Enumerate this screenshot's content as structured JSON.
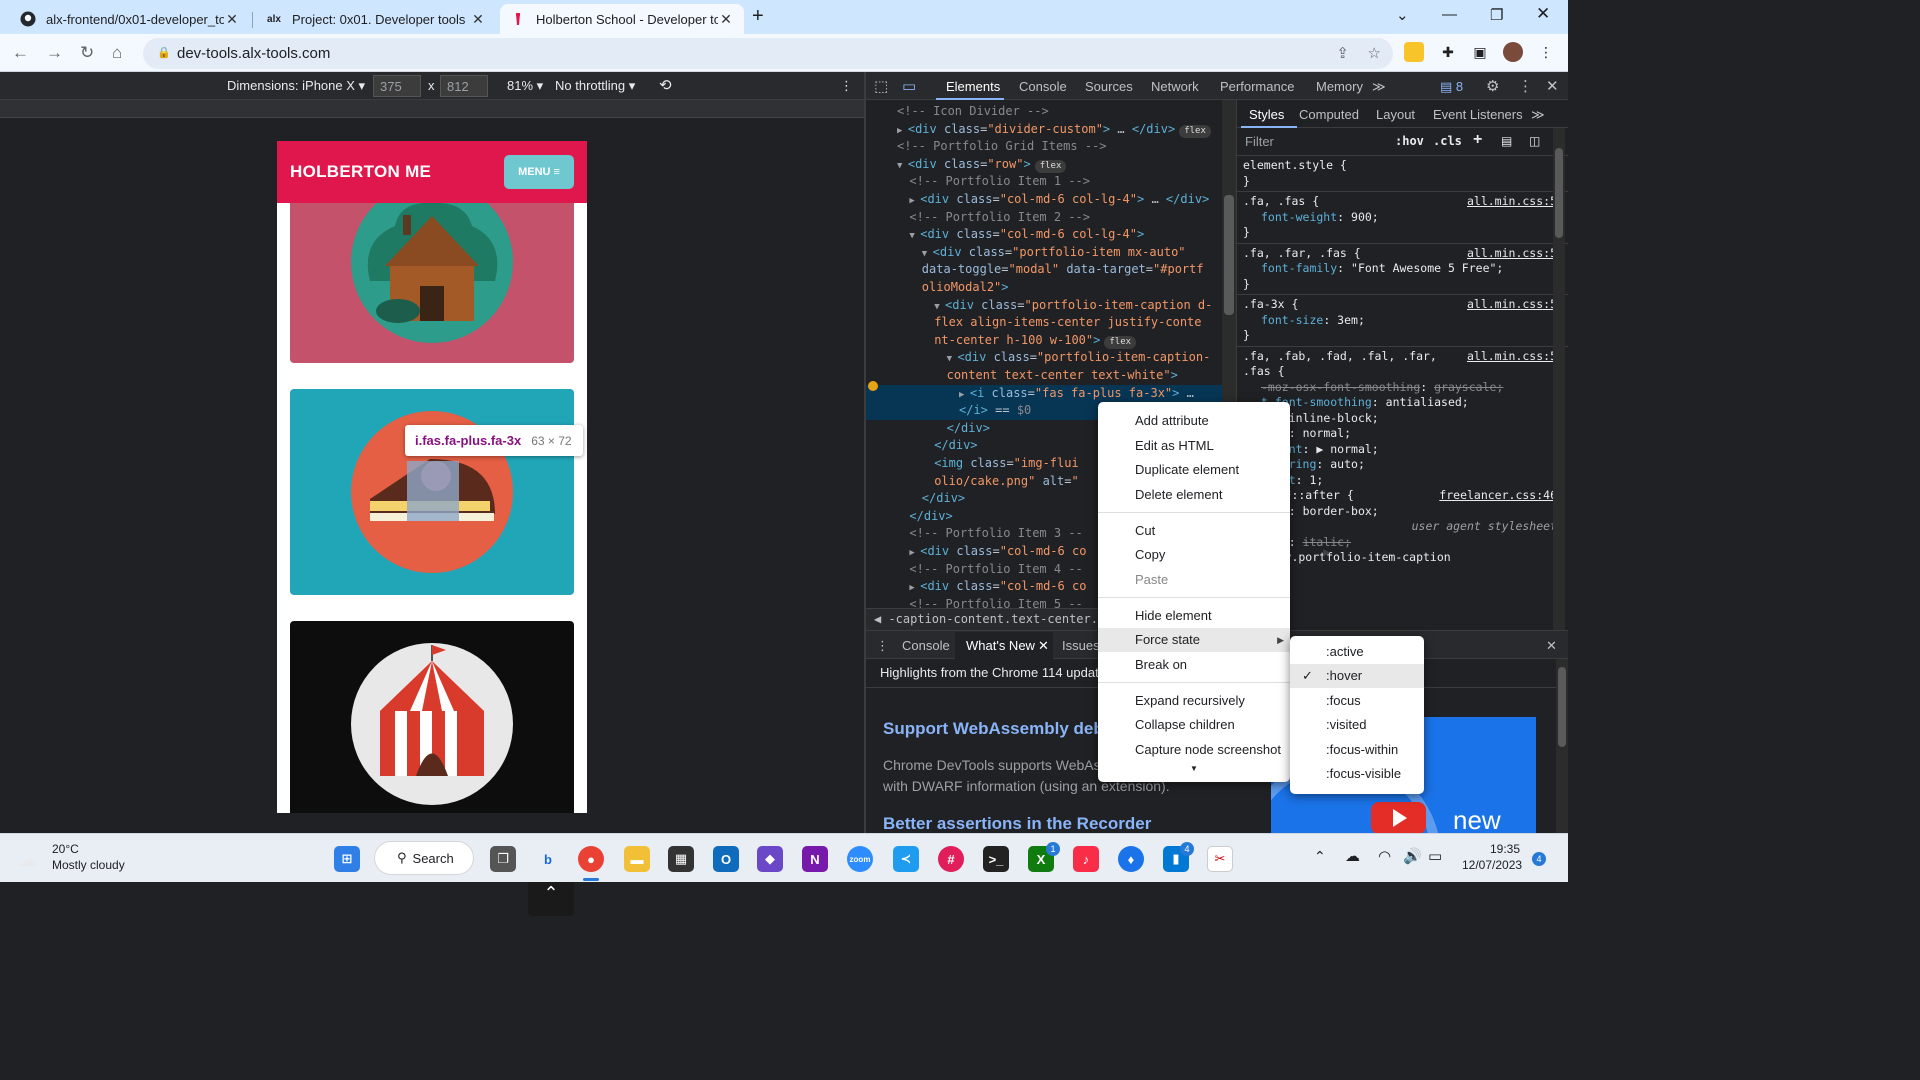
{
  "browser": {
    "tabs": [
      {
        "title": "alx-frontend/0x01-developer_too",
        "favicon": "github-icon"
      },
      {
        "title": "Project: 0x01. Developer tools | N",
        "favicon": "alx-icon"
      },
      {
        "title": "Holberton School - Developer to",
        "favicon": "holberton-icon"
      }
    ],
    "url": "dev-tools.alx-tools.com"
  },
  "device_toolbar": {
    "dimensions_label": "Dimensions: iPhone X",
    "width": "375",
    "times": "x",
    "height": "812",
    "zoom": "81%",
    "throttling": "No throttling"
  },
  "page": {
    "brand": "HOLBERTON ME",
    "menu_label": "MENU",
    "tooltip_selector": "i.fas.fa-plus.fa-3x",
    "tooltip_size": "63 × 72",
    "item_colors": [
      "#c4526a",
      "#21a6b8",
      "#0e0d0d"
    ]
  },
  "devtools": {
    "tabs": [
      "Elements",
      "Console",
      "Sources",
      "Network",
      "Performance",
      "Memory"
    ],
    "issues_count": "8",
    "elements_lines": [
      {
        "indent": 5,
        "arrow": "",
        "parts": [
          [
            "cm",
            "<!-- Icon Divider -->"
          ]
        ]
      },
      {
        "indent": 5,
        "arrow": "▶",
        "parts": [
          [
            "tag",
            "<div "
          ],
          [
            "an",
            "class"
          ],
          [
            "pl",
            "="
          ],
          [
            "av",
            "\"divider-custom\""
          ],
          [
            "tag",
            ">"
          ],
          [
            "pl",
            " … "
          ],
          [
            "tag",
            "</div>"
          ]
        ],
        "badge": "flex"
      },
      {
        "indent": 5,
        "arrow": "",
        "parts": [
          [
            "cm",
            "<!-- Portfolio Grid Items -->"
          ]
        ]
      },
      {
        "indent": 5,
        "arrow": "▼",
        "parts": [
          [
            "tag",
            "<div "
          ],
          [
            "an",
            "class"
          ],
          [
            "pl",
            "="
          ],
          [
            "av",
            "\"row\""
          ],
          [
            "tag",
            ">"
          ]
        ],
        "badge": "flex"
      },
      {
        "indent": 7,
        "arrow": "",
        "parts": [
          [
            "cm",
            "<!-- Portfolio Item 1 -->"
          ]
        ]
      },
      {
        "indent": 7,
        "arrow": "▶",
        "parts": [
          [
            "tag",
            "<div "
          ],
          [
            "an",
            "class"
          ],
          [
            "pl",
            "="
          ],
          [
            "av",
            "\"col-md-6 col-lg-4\""
          ],
          [
            "tag",
            ">"
          ],
          [
            "pl",
            " … "
          ],
          [
            "tag",
            "</div>"
          ]
        ]
      },
      {
        "indent": 7,
        "arrow": "",
        "parts": [
          [
            "cm",
            "<!-- Portfolio Item 2 -->"
          ]
        ]
      },
      {
        "indent": 7,
        "arrow": "▼",
        "parts": [
          [
            "tag",
            "<div "
          ],
          [
            "an",
            "class"
          ],
          [
            "pl",
            "="
          ],
          [
            "av",
            "\"col-md-6 col-lg-4\""
          ],
          [
            "tag",
            ">"
          ]
        ]
      },
      {
        "indent": 9,
        "arrow": "▼",
        "parts": [
          [
            "tag",
            "<div "
          ],
          [
            "an",
            "class"
          ],
          [
            "pl",
            "="
          ],
          [
            "av",
            "\"portfolio-item mx-auto\""
          ]
        ]
      },
      {
        "indent": 9,
        "arrow": "",
        "parts": [
          [
            "an",
            "data-toggle"
          ],
          [
            "pl",
            "="
          ],
          [
            "av",
            "\"modal\" "
          ],
          [
            "an",
            "data-target"
          ],
          [
            "pl",
            "="
          ],
          [
            "av",
            "\"#portf"
          ]
        ]
      },
      {
        "indent": 9,
        "arrow": "",
        "parts": [
          [
            "av",
            "olioModal2\""
          ],
          [
            "tag",
            ">"
          ]
        ]
      },
      {
        "indent": 11,
        "arrow": "▼",
        "parts": [
          [
            "tag",
            "<div "
          ],
          [
            "an",
            "class"
          ],
          [
            "pl",
            "="
          ],
          [
            "av",
            "\"portfolio-item-caption d-"
          ]
        ]
      },
      {
        "indent": 11,
        "arrow": "",
        "parts": [
          [
            "av",
            "flex align-items-center justify-conte"
          ]
        ]
      },
      {
        "indent": 11,
        "arrow": "",
        "parts": [
          [
            "av",
            "nt-center h-100 w-100\""
          ],
          [
            "tag",
            ">"
          ]
        ],
        "badge": "flex"
      },
      {
        "indent": 13,
        "arrow": "▼",
        "parts": [
          [
            "tag",
            "<div "
          ],
          [
            "an",
            "class"
          ],
          [
            "pl",
            "="
          ],
          [
            "av",
            "\"portfolio-item-caption-"
          ]
        ]
      },
      {
        "indent": 13,
        "arrow": "",
        "parts": [
          [
            "av",
            "content text-center text-white\""
          ],
          [
            "tag",
            ">"
          ]
        ]
      },
      {
        "indent": 15,
        "arrow": "▶",
        "parts": [
          [
            "tag",
            "<i "
          ],
          [
            "an",
            "class"
          ],
          [
            "pl",
            "="
          ],
          [
            "av",
            "\"fas fa-plus fa-3x\""
          ],
          [
            "tag",
            ">"
          ],
          [
            "pl",
            " … "
          ]
        ],
        "selected": true
      },
      {
        "indent": 15,
        "arrow": "",
        "parts": [
          [
            "tag",
            "</i>"
          ],
          [
            "pl",
            " == "
          ],
          [
            "cm",
            "$0"
          ]
        ],
        "selected": true
      },
      {
        "indent": 13,
        "arrow": "",
        "parts": [
          [
            "tag",
            "</div>"
          ]
        ]
      },
      {
        "indent": 11,
        "arrow": "",
        "parts": [
          [
            "tag",
            "</div>"
          ]
        ]
      },
      {
        "indent": 11,
        "arrow": "",
        "parts": [
          [
            "tag",
            "<img "
          ],
          [
            "an",
            "class"
          ],
          [
            "pl",
            "="
          ],
          [
            "av",
            "\"img-flui"
          ]
        ]
      },
      {
        "indent": 11,
        "arrow": "",
        "parts": [
          [
            "av",
            "olio/cake.png\" "
          ],
          [
            "an",
            "alt"
          ],
          [
            "pl",
            "="
          ],
          [
            "av",
            "\""
          ]
        ]
      },
      {
        "indent": 9,
        "arrow": "",
        "parts": [
          [
            "tag",
            "</div>"
          ]
        ]
      },
      {
        "indent": 7,
        "arrow": "",
        "parts": [
          [
            "tag",
            "</div>"
          ]
        ]
      },
      {
        "indent": 7,
        "arrow": "",
        "parts": [
          [
            "cm",
            "<!-- Portfolio Item 3 --"
          ]
        ]
      },
      {
        "indent": 7,
        "arrow": "▶",
        "parts": [
          [
            "tag",
            "<div "
          ],
          [
            "an",
            "class"
          ],
          [
            "pl",
            "="
          ],
          [
            "av",
            "\"col-md-6 co"
          ]
        ]
      },
      {
        "indent": 7,
        "arrow": "",
        "parts": [
          [
            "cm",
            "<!-- Portfolio Item 4 --"
          ]
        ]
      },
      {
        "indent": 7,
        "arrow": "▶",
        "parts": [
          [
            "tag",
            "<div "
          ],
          [
            "an",
            "class"
          ],
          [
            "pl",
            "="
          ],
          [
            "av",
            "\"col-md-6 co"
          ]
        ]
      },
      {
        "indent": 7,
        "arrow": "",
        "parts": [
          [
            "cm",
            "<!-- Portfolio Item 5 --"
          ]
        ]
      }
    ],
    "breadcrumb": "-caption-content.text-center.text-white",
    "styles_tabs": [
      "Styles",
      "Computed",
      "Layout",
      "Event Listeners"
    ],
    "filter_placeholder": "Filter",
    "hov": ":hov",
    "cls": ".cls",
    "style_rules": [
      {
        "sel": "element.style {",
        "src": ""
      },
      {
        "close": "}"
      },
      {
        "sel": ".fa, .fas {",
        "src": "all.min.css:5"
      },
      {
        "prop": "font-weight",
        "val": "900;"
      },
      {
        "close": "}"
      },
      {
        "sel": ".fa, .far, .fas {",
        "src": "all.min.css:5"
      },
      {
        "prop": "font-family",
        "val": "\"Font Awesome 5 Free\";"
      },
      {
        "close": "}"
      },
      {
        "sel": ".fa-3x {",
        "src": "all.min.css:5"
      },
      {
        "prop": "font-size",
        "val": "3em;"
      },
      {
        "close": "}"
      },
      {
        "sel": ".fa, .fab, .fad, .fal, .far,",
        "src": "all.min.css:5"
      },
      {
        "sel": ".fas {",
        "src": ""
      },
      {
        "prop": "-moz-osx-font-smoothing",
        "val": "grayscale;",
        "strike": true
      },
      {
        "prop": "t-font-smoothing",
        "val": "antialiased;"
      },
      {
        "prop": "ay",
        "val": "inline-block;"
      },
      {
        "prop": "tyle",
        "val": "normal;"
      },
      {
        "prop": "ariant",
        "val": "▶ normal;"
      },
      {
        "prop": "endering",
        "val": "auto;"
      },
      {
        "prop": "eight",
        "val": "1;"
      },
      {
        "sel": "fore, *::after {",
        "src": "freelancer.css:46"
      },
      {
        "prop": "zing",
        "val": "border-box;"
      },
      {
        "ua": "user agent stylesheet"
      },
      {
        "prop": "tyle",
        "val": "italic;",
        "strike": true
      },
      {
        "sel": "rom div.portfolio-item-caption",
        "src": ""
      }
    ],
    "drawer_tabs": [
      "Console",
      "What's New",
      "Issues"
    ],
    "whatsnew": {
      "highlight": "Highlights from the Chrome 114 update",
      "heading1": "Support WebAssembly debu",
      "para1a": "Chrome DevTools supports WebAs",
      "para1b": "with DWARF information (using an extension).",
      "heading2": "Better assertions in the Recorder",
      "video_label": "new"
    }
  },
  "context_menu": {
    "items": [
      "Add attribute",
      "Edit as HTML",
      "Duplicate element",
      "Delete element",
      "Cut",
      "Copy",
      "Paste",
      "Hide element",
      "Force state",
      "Break on",
      "Expand recursively",
      "Collapse children",
      "Capture node screenshot"
    ],
    "force_states": [
      ":active",
      ":hover",
      ":focus",
      ":visited",
      ":focus-within",
      ":focus-visible"
    ]
  },
  "taskbar": {
    "weather_temp": "20°C",
    "weather_desc": "Mostly cloudy",
    "search_label": "Search",
    "time": "19:35",
    "date": "12/07/2023",
    "notif_count": "4",
    "xbox_badge": "1",
    "app_badge": "4"
  }
}
